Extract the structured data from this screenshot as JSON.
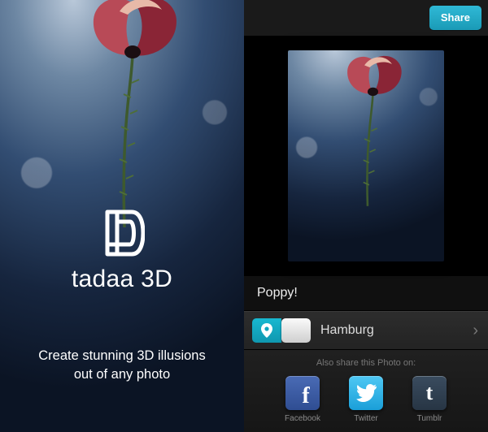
{
  "promo": {
    "app_name": "tadaa 3D",
    "tagline_line1": "Create stunning 3D illusions",
    "tagline_line2": "out of any photo"
  },
  "panel": {
    "share_button": "Share",
    "photo_title": "Poppy!",
    "location": {
      "name": "Hamburg",
      "enabled": true
    },
    "also_share_label": "Also share this Photo on:",
    "social": [
      {
        "key": "facebook",
        "label": "Facebook"
      },
      {
        "key": "twitter",
        "label": "Twitter"
      },
      {
        "key": "tumblr",
        "label": "Tumblr"
      }
    ]
  },
  "colors": {
    "accent": "#1aa9c4",
    "facebook": "#3b5998",
    "twitter": "#2caae1",
    "tumblr": "#2f3f52"
  }
}
